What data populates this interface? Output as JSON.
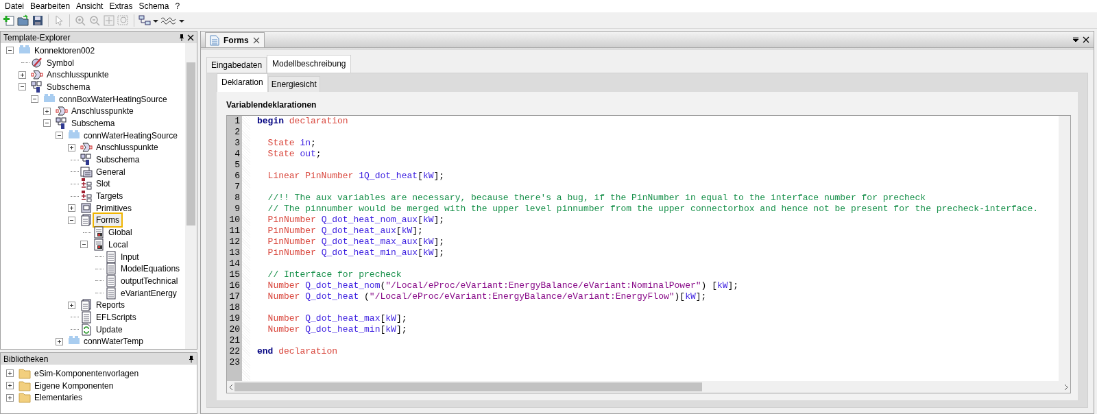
{
  "menu": [
    "Datei",
    "Bearbeiten",
    "Ansicht",
    "Extras",
    "Schema",
    "?"
  ],
  "template_explorer": {
    "title": "Template-Explorer",
    "tree": [
      {
        "label": "Konnektoren002",
        "kind": "component",
        "expanded": true,
        "highlighted": false,
        "children": [
          {
            "label": "Symbol",
            "kind": "symbol",
            "highlighted": false
          },
          {
            "label": "Anschlusspunkte",
            "kind": "connector",
            "expanded": false,
            "highlighted": false
          },
          {
            "label": "Subschema",
            "kind": "subschema",
            "expanded": true,
            "highlighted": false,
            "children": [
              {
                "label": "connBoxWaterHeatingSource",
                "kind": "component",
                "expanded": true,
                "highlighted": false,
                "children": [
                  {
                    "label": "Anschlusspunkte",
                    "kind": "connector",
                    "expanded": false,
                    "highlighted": false
                  },
                  {
                    "label": "Subschema",
                    "kind": "subschema",
                    "expanded": true,
                    "highlighted": false,
                    "children": [
                      {
                        "label": "connWaterHeatingSource",
                        "kind": "component",
                        "expanded": true,
                        "highlighted": false,
                        "children": [
                          {
                            "label": "Anschlusspunkte",
                            "kind": "connector",
                            "expanded": false,
                            "highlighted": false
                          },
                          {
                            "label": "Subschema",
                            "kind": "subschema",
                            "highlighted": false
                          },
                          {
                            "label": "General",
                            "kind": "general",
                            "highlighted": false
                          },
                          {
                            "label": "Slot",
                            "kind": "slot",
                            "highlighted": false
                          },
                          {
                            "label": "Targets",
                            "kind": "slot",
                            "highlighted": false
                          },
                          {
                            "label": "Primitives",
                            "kind": "primitives",
                            "expanded": false,
                            "highlighted": false
                          },
                          {
                            "label": "Forms",
                            "kind": "forms",
                            "expanded": true,
                            "highlighted": true,
                            "children": [
                              {
                                "label": "Global",
                                "kind": "formgroup",
                                "highlighted": false
                              },
                              {
                                "label": "Local",
                                "kind": "formgroup",
                                "expanded": true,
                                "highlighted": false,
                                "children": [
                                  {
                                    "label": "Input",
                                    "kind": "form",
                                    "highlighted": false
                                  },
                                  {
                                    "label": "ModelEquations",
                                    "kind": "form",
                                    "highlighted": false
                                  },
                                  {
                                    "label": "outputTechnical",
                                    "kind": "form",
                                    "highlighted": false
                                  },
                                  {
                                    "label": "eVariantEnergy",
                                    "kind": "form",
                                    "highlighted": false
                                  }
                                ]
                              }
                            ]
                          },
                          {
                            "label": "Reports",
                            "kind": "forms",
                            "expanded": false,
                            "highlighted": false
                          },
                          {
                            "label": "EFLScripts",
                            "kind": "form",
                            "highlighted": false
                          },
                          {
                            "label": "Update",
                            "kind": "update",
                            "highlighted": false
                          }
                        ]
                      },
                      {
                        "label": "connWaterTemp",
                        "kind": "component",
                        "expanded": false,
                        "highlighted": false
                      }
                    ]
                  }
                ]
              }
            ]
          }
        ]
      }
    ]
  },
  "libraries": {
    "title": "Bibliotheken",
    "items": [
      {
        "label": "eSim-Komponentenvorlagen",
        "expanded": false
      },
      {
        "label": "Eigene Komponenten",
        "expanded": false
      },
      {
        "label": "Elementaries",
        "expanded": false
      }
    ]
  },
  "document_tabs": [
    {
      "label": "Forms",
      "selected": true
    }
  ],
  "tabs": [
    {
      "label": "Eingabedaten",
      "selected": false
    },
    {
      "label": "Modellbeschreibung",
      "selected": true
    }
  ],
  "subtabs": [
    {
      "label": "Deklaration",
      "selected": true
    },
    {
      "label": "Energiesicht",
      "selected": false
    }
  ],
  "section_title": "Variablendeklarationen",
  "code_lines": [
    {
      "number": "1",
      "tokens": [
        {
          "kind": "keyword",
          "text": "begin"
        },
        {
          "kind": "type",
          "text": " declaration"
        }
      ]
    },
    {
      "number": "2"
    },
    {
      "number": "3",
      "tokens": [
        {
          "kind": "type",
          "text": "  State"
        },
        {
          "kind": "ident",
          "text": " in"
        },
        {
          "kind": "plain",
          "text": ";"
        }
      ]
    },
    {
      "number": "4",
      "tokens": [
        {
          "kind": "type",
          "text": "  State"
        },
        {
          "kind": "ident",
          "text": " out"
        },
        {
          "kind": "plain",
          "text": ";"
        }
      ]
    },
    {
      "number": "5"
    },
    {
      "number": "6",
      "tokens": [
        {
          "kind": "type",
          "text": "  Linear PinNumber"
        },
        {
          "kind": "ident",
          "text": " 1Q_dot_heat"
        },
        {
          "kind": "plain",
          "text": "["
        },
        {
          "kind": "ident",
          "text": "kW"
        },
        {
          "kind": "plain",
          "text": "];"
        }
      ]
    },
    {
      "number": "7"
    },
    {
      "number": "8",
      "tokens": [
        {
          "kind": "comment",
          "text": "  //!! The aux variables are necessary, because there's a bug, if the PinNumber in equal to the interface number for precheck"
        }
      ]
    },
    {
      "number": "9",
      "tokens": [
        {
          "kind": "comment",
          "text": "  // The pinnumber would be merged with the upper level pinnumber from the upper connectorbox and hence not be present for the precheck-interface."
        }
      ]
    },
    {
      "number": "10",
      "tokens": [
        {
          "kind": "type",
          "text": "  PinNumber"
        },
        {
          "kind": "ident",
          "text": " Q_dot_heat_nom_aux"
        },
        {
          "kind": "plain",
          "text": "["
        },
        {
          "kind": "ident",
          "text": "kW"
        },
        {
          "kind": "plain",
          "text": "];"
        }
      ]
    },
    {
      "number": "11",
      "tokens": [
        {
          "kind": "type",
          "text": "  PinNumber"
        },
        {
          "kind": "ident",
          "text": " Q_dot_heat_aux"
        },
        {
          "kind": "plain",
          "text": "["
        },
        {
          "kind": "ident",
          "text": "kW"
        },
        {
          "kind": "plain",
          "text": "];"
        }
      ]
    },
    {
      "number": "12",
      "tokens": [
        {
          "kind": "type",
          "text": "  PinNumber"
        },
        {
          "kind": "ident",
          "text": " Q_dot_heat_max_aux"
        },
        {
          "kind": "plain",
          "text": "["
        },
        {
          "kind": "ident",
          "text": "kW"
        },
        {
          "kind": "plain",
          "text": "];"
        }
      ]
    },
    {
      "number": "13",
      "tokens": [
        {
          "kind": "type",
          "text": "  PinNumber"
        },
        {
          "kind": "ident",
          "text": " Q_dot_heat_min_aux"
        },
        {
          "kind": "plain",
          "text": "["
        },
        {
          "kind": "ident",
          "text": "kW"
        },
        {
          "kind": "plain",
          "text": "];"
        }
      ]
    },
    {
      "number": "14"
    },
    {
      "number": "15",
      "tokens": [
        {
          "kind": "comment",
          "text": "  // Interface for precheck"
        }
      ]
    },
    {
      "number": "16",
      "tokens": [
        {
          "kind": "type",
          "text": "  Number"
        },
        {
          "kind": "ident",
          "text": " Q_dot_heat_nom"
        },
        {
          "kind": "plain",
          "text": "("
        },
        {
          "kind": "string",
          "text": "\"/Local/eProc/eVariant:EnergyBalance/eVariant:NominalPower\""
        },
        {
          "kind": "plain",
          "text": ") ["
        },
        {
          "kind": "ident",
          "text": "kW"
        },
        {
          "kind": "plain",
          "text": "];"
        }
      ]
    },
    {
      "number": "17",
      "tokens": [
        {
          "kind": "type",
          "text": "  Number"
        },
        {
          "kind": "ident",
          "text": " Q_dot_heat"
        },
        {
          "kind": "plain",
          "text": " ("
        },
        {
          "kind": "string",
          "text": "\"/Local/eProc/eVariant:EnergyBalance/eVariant:EnergyFlow\""
        },
        {
          "kind": "plain",
          "text": ")["
        },
        {
          "kind": "ident",
          "text": "kW"
        },
        {
          "kind": "plain",
          "text": "];"
        }
      ]
    },
    {
      "number": "18"
    },
    {
      "number": "19",
      "tokens": [
        {
          "kind": "type",
          "text": "  Number"
        },
        {
          "kind": "ident",
          "text": " Q_dot_heat_max"
        },
        {
          "kind": "plain",
          "text": "["
        },
        {
          "kind": "ident",
          "text": "kW"
        },
        {
          "kind": "plain",
          "text": "];"
        }
      ]
    },
    {
      "number": "20",
      "tokens": [
        {
          "kind": "type",
          "text": "  Number"
        },
        {
          "kind": "ident",
          "text": " Q_dot_heat_min"
        },
        {
          "kind": "plain",
          "text": "["
        },
        {
          "kind": "ident",
          "text": "kW"
        },
        {
          "kind": "plain",
          "text": "];"
        }
      ]
    },
    {
      "number": "21"
    },
    {
      "number": "22",
      "tokens": [
        {
          "kind": "keyword",
          "text": "end"
        },
        {
          "kind": "type",
          "text": " declaration"
        }
      ]
    },
    {
      "number": "23"
    }
  ]
}
